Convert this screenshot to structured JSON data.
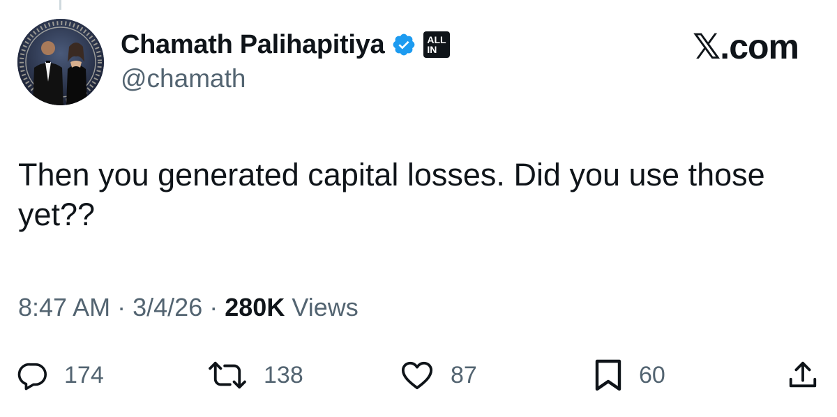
{
  "tweet": {
    "author": {
      "display_name": "Chamath Palihapitiya",
      "handle": "@chamath",
      "verified": true,
      "affiliate_badge": [
        "ALL",
        "IN"
      ]
    },
    "brand": "𝕏.com",
    "text": "Then you generated capital losses. Did you use those yet??",
    "meta": {
      "time": "8:47 AM",
      "separator": "·",
      "date": "3/4/26",
      "views_count": "280K",
      "views_label": "Views"
    },
    "actions": {
      "replies": "174",
      "reposts": "138",
      "likes": "87",
      "bookmarks": "60"
    },
    "colors": {
      "text": "#0f1419",
      "secondary": "#536471",
      "verified": "#1d9bf0"
    },
    "icons": [
      "reply-icon",
      "repost-icon",
      "like-icon",
      "bookmark-icon",
      "share-icon",
      "verified-icon"
    ]
  }
}
